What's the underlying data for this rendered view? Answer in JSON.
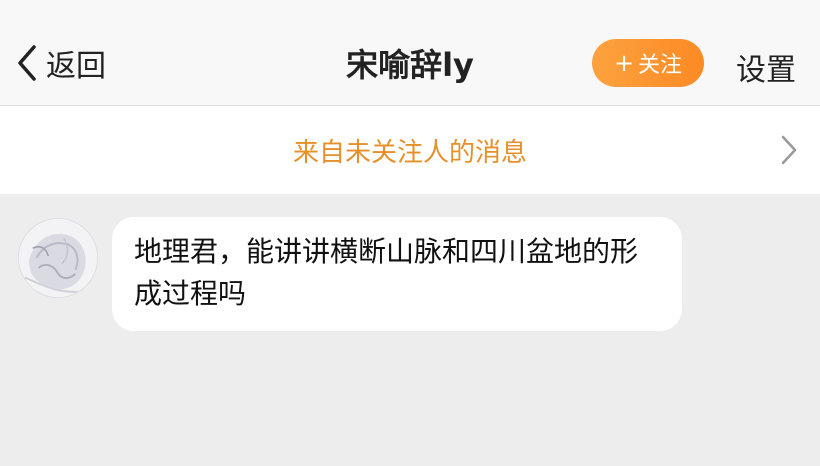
{
  "header": {
    "back_label": "返回",
    "title": "宋喻辞ly",
    "follow_label": "关注",
    "follow_color": "#fb8a24",
    "settings_label": "设置"
  },
  "notice": {
    "text": "来自未关注人的消息",
    "text_color": "#e6902a",
    "icon": "chevron-right-icon"
  },
  "messages": [
    {
      "sender": "other",
      "avatar": "avatar-image",
      "text": "地理君，能讲讲横断山脉和四川盆地的形成过程吗"
    }
  ]
}
